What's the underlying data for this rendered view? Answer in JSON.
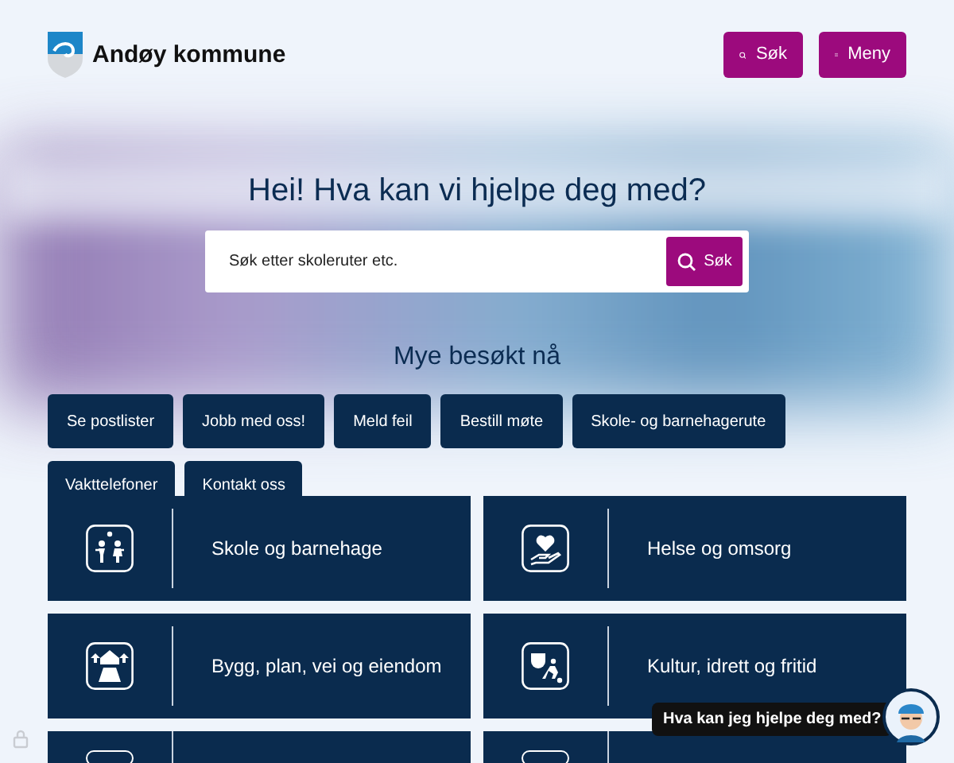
{
  "header": {
    "logo_text": "Andøy kommune",
    "buttons": [
      {
        "kind": "search",
        "label": "Søk"
      },
      {
        "kind": "menu",
        "label": "Meny"
      }
    ]
  },
  "hero": {
    "heading": "Hei! Hva kan vi hjelpe deg med?",
    "search": {
      "placeholder": "Søk etter skoleruter etc.",
      "button": "Søk"
    }
  },
  "popular": {
    "title": "Mye besøkt nå",
    "links": [
      "Se postlister",
      "Jobb med oss!",
      "Meld feil",
      "Bestill møte",
      "Skole- og barnehagerute"
    ],
    "links_row_2": [
      "Vakttelefoner",
      "Kontakt oss"
    ]
  },
  "categories": [
    {
      "kind": "school",
      "label": "Skole og barnehage"
    },
    {
      "kind": "health",
      "label": "Helse og omsorg"
    },
    {
      "kind": "building",
      "label": "Bygg, plan, vei og eiendom"
    },
    {
      "kind": "culture",
      "label": "Kultur, idrett og fritid"
    }
  ],
  "chat": {
    "prompt": "Hva kan jeg hjelpe deg med?"
  }
}
